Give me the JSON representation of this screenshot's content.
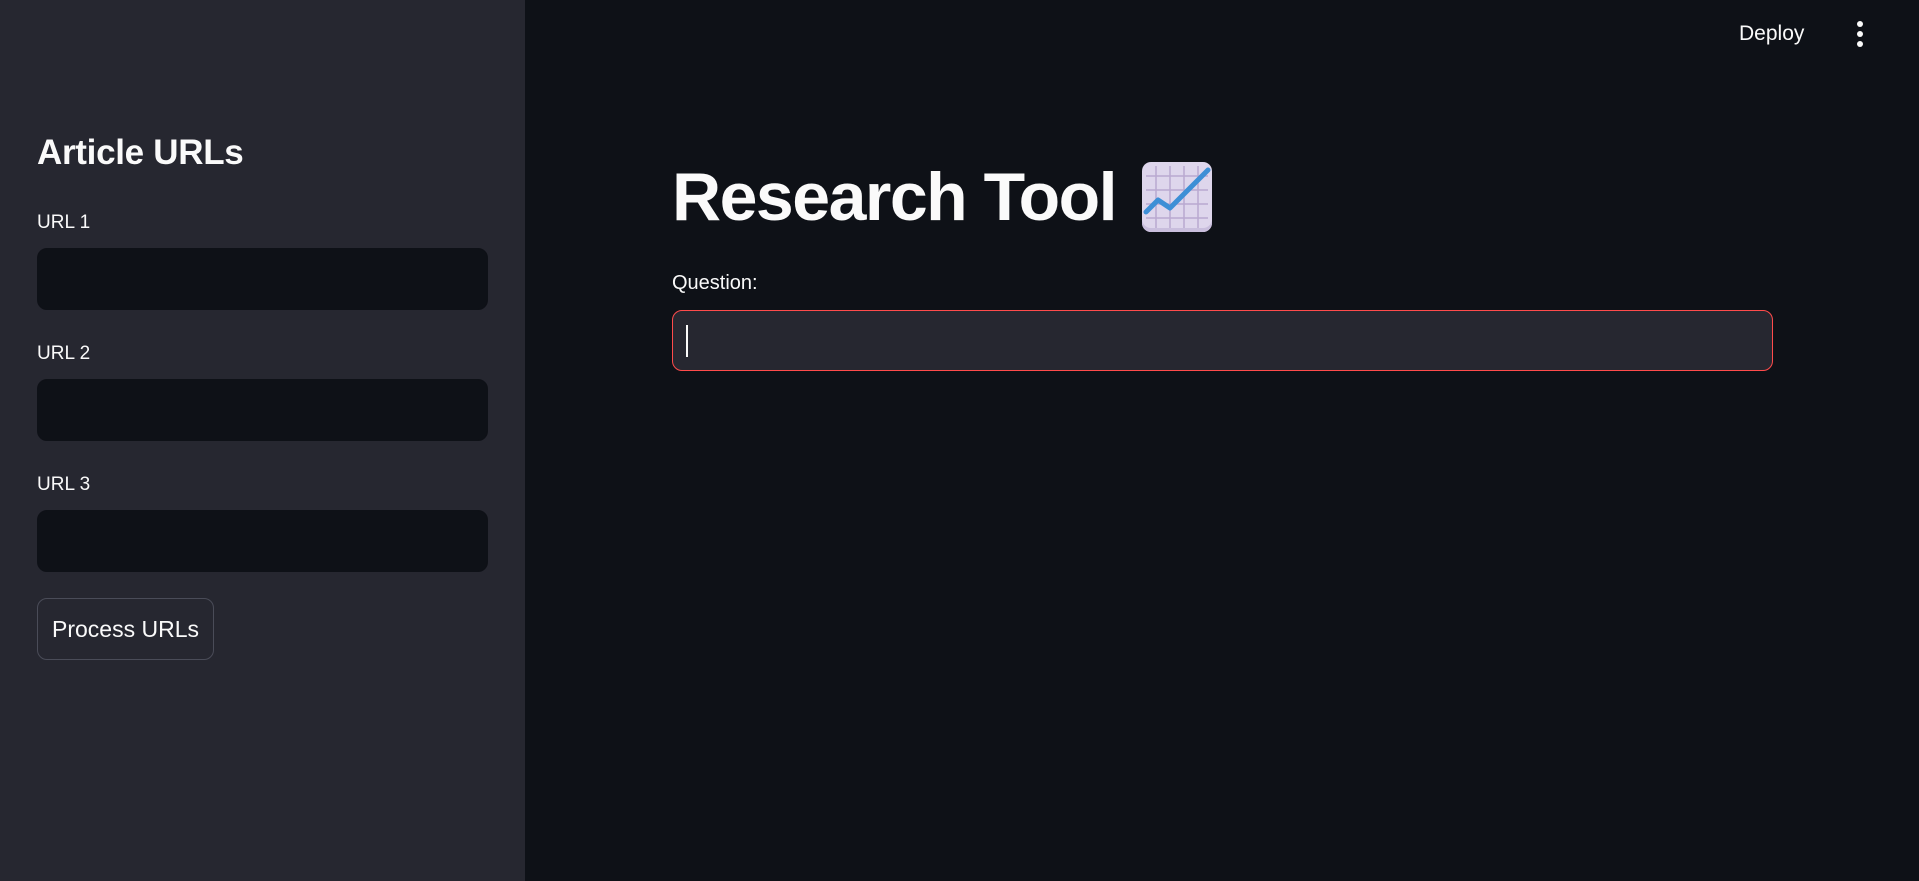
{
  "header": {
    "deploy_label": "Deploy",
    "menu_icon": "vertical-ellipsis-icon"
  },
  "sidebar": {
    "heading": "Article URLs",
    "fields": [
      {
        "label": "URL 1",
        "value": "",
        "placeholder": ""
      },
      {
        "label": "URL 2",
        "value": "",
        "placeholder": ""
      },
      {
        "label": "URL 3",
        "value": "",
        "placeholder": ""
      }
    ],
    "process_button_label": "Process URLs"
  },
  "main": {
    "title": "Research Tool",
    "title_icon": "chart-increasing-icon",
    "question": {
      "label": "Question:",
      "value": "",
      "placeholder": ""
    }
  },
  "colors": {
    "background": "#0e1117",
    "sidebar": "#262730",
    "text": "#fafafa",
    "focus_border": "#ff4b4b"
  }
}
